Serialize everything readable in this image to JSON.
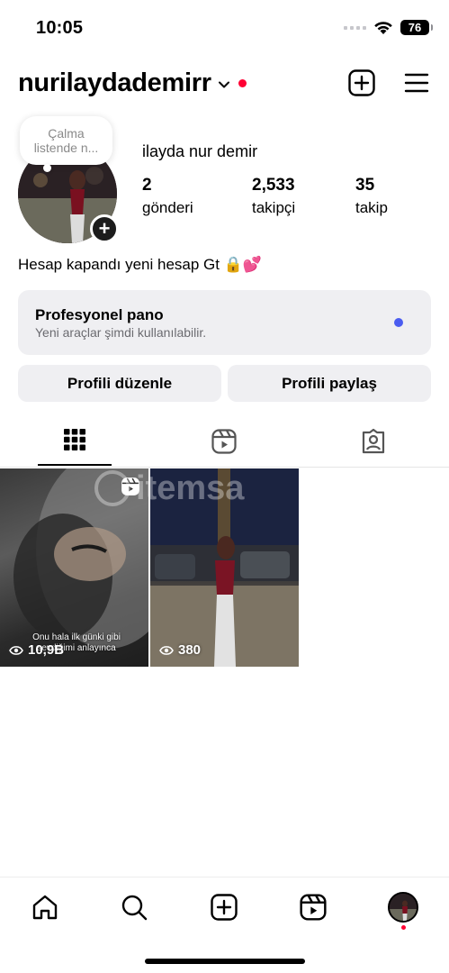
{
  "status_bar": {
    "time": "10:05",
    "battery": "76"
  },
  "header": {
    "username": "nurilaydademirr"
  },
  "note": {
    "text_line1": "Çalma",
    "text_line2": "listende n..."
  },
  "profile": {
    "full_name": "ilayda nur demir",
    "stats": [
      {
        "value": "2",
        "label": "gönderi"
      },
      {
        "value": "2,533",
        "label": "takipçi"
      },
      {
        "value": "35",
        "label": "takip"
      }
    ],
    "bio": "Hesap kapandı yeni hesap Gt 🔒💕"
  },
  "dashboard": {
    "title": "Profesyonel pano",
    "subtitle": "Yeni araçlar şimdi kullanılabilir."
  },
  "buttons": {
    "edit": "Profili düzenle",
    "share": "Profili paylaş"
  },
  "posts": [
    {
      "views": "10,9B",
      "caption": "Onu hala ilk günki gibi sevdiğimi anlayınca",
      "is_reel": true
    },
    {
      "views": "380",
      "is_reel": false
    }
  ],
  "watermark": "itemsa",
  "colors": {
    "accent": "#4a5cf0",
    "notification": "#ff0033",
    "card": "#efeff2"
  }
}
